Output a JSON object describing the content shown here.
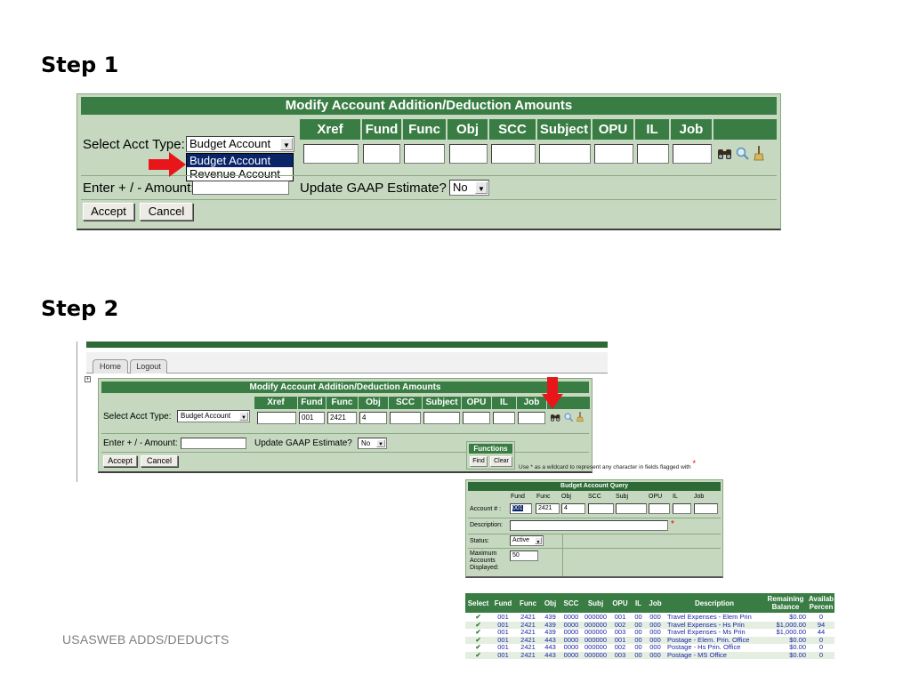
{
  "step1": {
    "title": "Step 1",
    "form": {
      "titlebar": "Modify Account Addition/Deduction Amounts",
      "select_acct_type_label": "Select Acct Type:",
      "select_acct_type_value": "Budget Account",
      "dropdown_options": [
        "Budget Account",
        "Revenue Account"
      ],
      "columns": [
        "Xref",
        "Fund",
        "Func",
        "Obj",
        "SCC",
        "Subject",
        "OPU",
        "IL",
        "Job"
      ],
      "amount_label": "Enter + / - Amount:",
      "amount_value": "",
      "gaap_label": "Update GAAP Estimate?",
      "gaap_value": "No",
      "accept_label": "Accept",
      "cancel_label": "Cancel"
    }
  },
  "step2": {
    "title": "Step 2",
    "nav": {
      "home": "Home",
      "logout": "Logout"
    },
    "form": {
      "titlebar": "Modify Account Addition/Deduction Amounts",
      "select_acct_type_label": "Select Acct Type:",
      "select_acct_type_value": "Budget Account",
      "columns": [
        "Xref",
        "Fund",
        "Func",
        "Obj",
        "SCC",
        "Subject",
        "OPU",
        "IL",
        "Job"
      ],
      "values": {
        "xref": "",
        "fund": "001",
        "func": "2421",
        "obj": "4",
        "scc": "",
        "subject": "",
        "opu": "",
        "il": "",
        "job": ""
      },
      "amount_label": "Enter + / - Amount:",
      "gaap_label": "Update GAAP Estimate?",
      "gaap_value": "No",
      "accept_label": "Accept",
      "cancel_label": "Cancel"
    },
    "functions": {
      "title": "Functions",
      "find": "Find",
      "clear": "Clear",
      "hint": "Use * as a wildcard to represent any character in fields flagged with",
      "hint_star": "*"
    },
    "query": {
      "title": "Budget Account Query",
      "columns": [
        "Fund",
        "Func",
        "Obj",
        "SCC",
        "Subj",
        "OPU",
        "IL",
        "Job"
      ],
      "account_label": "Account # :",
      "account_values": {
        "fund": "001",
        "func": "2421",
        "obj": "4"
      },
      "description_label": "Description:",
      "description_star": "*",
      "status_label": "Status:",
      "status_value": "Active",
      "max_label_1": "Maximum",
      "max_label_2": "Accounts",
      "max_label_3": "Displayed:",
      "max_value": "50"
    },
    "results": {
      "headers": [
        "Select",
        "Fund",
        "Func",
        "Obj",
        "SCC",
        "Subj",
        "OPU",
        "IL",
        "Job",
        "Description",
        "Remaining Balance",
        "Availab Percen"
      ],
      "rows": [
        [
          "001",
          "2421",
          "439",
          "0000",
          "000000",
          "001",
          "00",
          "000",
          "Travel Expenses - Elem Prin",
          "$0.00",
          "0"
        ],
        [
          "001",
          "2421",
          "439",
          "0000",
          "000000",
          "002",
          "00",
          "000",
          "Travel Expenses - Hs Prin",
          "$1,000.00",
          "94"
        ],
        [
          "001",
          "2421",
          "439",
          "0000",
          "000000",
          "003",
          "00",
          "000",
          "Travel Expenses - Ms Prin",
          "$1,000.00",
          "44"
        ],
        [
          "001",
          "2421",
          "443",
          "0000",
          "000000",
          "001",
          "00",
          "000",
          "Postage - Elem. Prin. Office",
          "$0.00",
          "0"
        ],
        [
          "001",
          "2421",
          "443",
          "0000",
          "000000",
          "002",
          "00",
          "000",
          "Postage - Hs Prin. Office",
          "$0.00",
          "0"
        ],
        [
          "001",
          "2421",
          "443",
          "0000",
          "000000",
          "003",
          "00",
          "000",
          "Postage - MS Office",
          "$0.00",
          "0"
        ]
      ]
    }
  },
  "footer": {
    "text": "USASWEB ADDS/DEDUCTS"
  },
  "colors": {
    "green_header": "#3a7d44",
    "form_bg": "#c6d9c0",
    "arrow_red": "#e8161b",
    "row_blue": "#1d26a8"
  }
}
